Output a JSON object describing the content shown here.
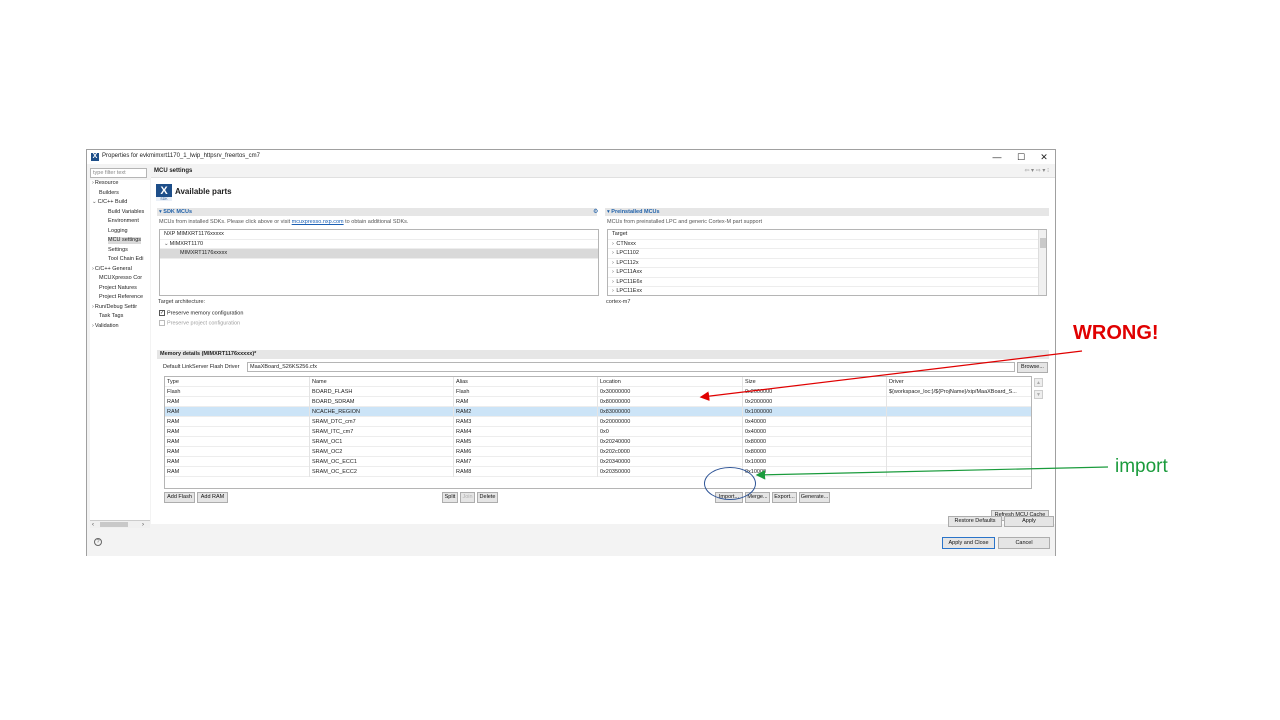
{
  "window": {
    "title": "Properties for evkmimxrt1170_1_lwip_httpsrv_freertos_cm7",
    "min": "—",
    "max": "☐",
    "close": "✕"
  },
  "nav": {
    "filter_placeholder": "type filter text",
    "items": [
      {
        "label": "Resource",
        "chevron": "›"
      },
      {
        "label": "Builders",
        "chevron": ""
      },
      {
        "label": "C/C++ Build",
        "chevron": "⌄"
      },
      {
        "label": "Build Variables",
        "chevron": ""
      },
      {
        "label": "Environment",
        "chevron": ""
      },
      {
        "label": "Logging",
        "chevron": ""
      },
      {
        "label": "MCU settings",
        "chevron": ""
      },
      {
        "label": "Settings",
        "chevron": ""
      },
      {
        "label": "Tool Chain Edi",
        "chevron": ""
      },
      {
        "label": "C/C++ General",
        "chevron": "›"
      },
      {
        "label": "MCUXpresso Cor",
        "chevron": ""
      },
      {
        "label": "Project Natures",
        "chevron": ""
      },
      {
        "label": "Project Reference",
        "chevron": ""
      },
      {
        "label": "Run/Debug Settir",
        "chevron": "›"
      },
      {
        "label": "Task Tags",
        "chevron": ""
      },
      {
        "label": "Validation",
        "chevron": "›"
      }
    ],
    "scroll_left": "‹",
    "scroll_right": "›"
  },
  "pane": {
    "title": "MCU settings",
    "nav_arrows": "⇦ ▾ ⇨ ▾ ⁝",
    "avail_title": "Available parts",
    "sdk_logo": "X",
    "sdk_logo_sub": "SDK"
  },
  "sdk_mcus": {
    "header": "SDK MCUs",
    "desc_before": "MCUs from installed SDKs. Please click above or visit ",
    "desc_link": "mcuxpresso.nxp.com",
    "desc_after": " to obtain additional SDKs.",
    "items": [
      "NXP MIMXRT1176xxxxx",
      "MIMXRT1170",
      "MIMXRT1176xxxxx"
    ],
    "item_chev": "⌄",
    "arch_label": "Target architecture:",
    "icon": "⚙"
  },
  "preinstalled": {
    "header": "Preinstalled MCUs",
    "desc": "MCUs from preinstalled LPC and generic Cortex-M part support",
    "items": [
      "Target",
      "CTNxxx",
      "LPC1102",
      "LPC112x",
      "LPC11Axx",
      "LPC11E6x",
      "LPC11Exx"
    ],
    "item_chev": "›",
    "arch_value": "cortex-m7"
  },
  "options": {
    "preserve_memory": "Preserve memory configuration",
    "preserve_project": "Preserve project configuration",
    "check_mark": "✓"
  },
  "memory": {
    "header": "Memory details (MIMXRT1176xxxxx)*",
    "driver_label": "Default LinkServer Flash Driver",
    "driver_value": "MaaXBoard_S26KS256.cfx",
    "browse": "Browse...",
    "columns": [
      "Type",
      "Name",
      "Alias",
      "Location",
      "Size",
      "Driver"
    ],
    "rows": [
      [
        "Flash",
        "BOARD_FLASH",
        "Flash",
        "0x30000000",
        "0x2000000",
        "${workspace_loc:}/${ProjName}/xip/MaaXBoard_S..."
      ],
      [
        "RAM",
        "BOARD_SDRAM",
        "RAM",
        "0x80000000",
        "0x2000000",
        ""
      ],
      [
        "RAM",
        "NCACHE_REGION",
        "RAM2",
        "0x83000000",
        "0x1000000",
        ""
      ],
      [
        "RAM",
        "SRAM_DTC_cm7",
        "RAM3",
        "0x20000000",
        "0x40000",
        ""
      ],
      [
        "RAM",
        "SRAM_ITC_cm7",
        "RAM4",
        "0x0",
        "0x40000",
        ""
      ],
      [
        "RAM",
        "SRAM_OC1",
        "RAM5",
        "0x20240000",
        "0x80000",
        ""
      ],
      [
        "RAM",
        "SRAM_OC2",
        "RAM6",
        "0x202c0000",
        "0x80000",
        ""
      ],
      [
        "RAM",
        "SRAM_OC_ECC1",
        "RAM7",
        "0x20340000",
        "0x10000",
        ""
      ],
      [
        "RAM",
        "SRAM_OC_ECC2",
        "RAM8",
        "0x20350000",
        "0x10000",
        ""
      ]
    ],
    "side_up": "▲",
    "side_down": "▼",
    "buttons": {
      "add_flash": "Add Flash",
      "add_ram": "Add RAM",
      "split": "Split",
      "join": "Join",
      "delete": "Delete",
      "import": "Import...",
      "merge": "Merge...",
      "export": "Export...",
      "generate": "Generate..."
    },
    "refresh": "Refresh MCU Cache"
  },
  "footer": {
    "restore": "Restore Defaults",
    "apply": "Apply",
    "apply_close": "Apply and Close",
    "cancel": "Cancel",
    "help": "?"
  },
  "annotations": {
    "wrong": "WRONG!",
    "import": "import",
    "wrong_color": "#e00000",
    "import_color": "#1a9b3c",
    "circle_color": "#2f5597"
  }
}
